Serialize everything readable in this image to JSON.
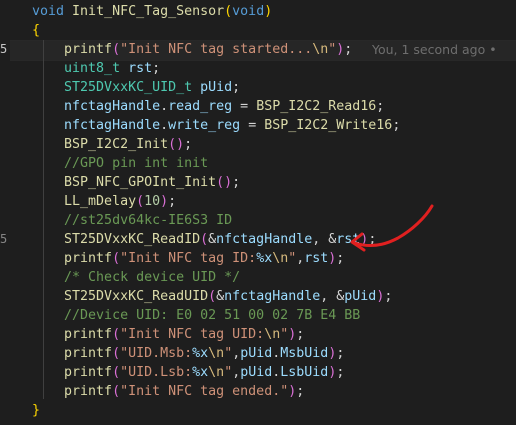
{
  "editor": {
    "line_numbers": [
      "",
      "",
      "5",
      "",
      "",
      "",
      "",
      "",
      "",
      "",
      "",
      "",
      "",
      "",
      "5",
      "",
      "",
      "",
      "",
      "",
      "",
      ""
    ],
    "blame": "You, 1 second ago •"
  },
  "code": {
    "l0": {
      "kw": "void",
      "fn": "Init_NFC_Tag_Sensor",
      "p1": "(",
      "arg": "void",
      "p2": ")"
    },
    "l1": {
      "brace": "{"
    },
    "l2": {
      "fn": "printf",
      "p1": "(",
      "str1": "\"Init NFC tag started...",
      "esc": "\\n",
      "str2": "\"",
      "p2": ")",
      "semi": ";"
    },
    "l3": {
      "ty": "uint8_t",
      "var": "rst",
      "semi": ";"
    },
    "l4": {
      "ty": "ST25DVxxKC_UID_t",
      "var": "pUid",
      "semi": ";"
    },
    "l5": {
      "var1": "nfctagHandle",
      "dot": ".",
      "var2": "read_reg",
      "eq": " = ",
      "fn": "BSP_I2C2_Read16",
      "semi": ";"
    },
    "l6": {
      "var1": "nfctagHandle",
      "dot": ".",
      "var2": "write_reg",
      "eq": " = ",
      "fn": "BSP_I2C2_Write16",
      "semi": ";"
    },
    "l7": {
      "fn": "BSP_I2C2_Init",
      "p": "()",
      "semi": ";"
    },
    "l8": {
      "cmt": "//GPO pin int init"
    },
    "l9": {
      "fn": "BSP_NFC_GPOInt_Init",
      "p": "()",
      "semi": ";"
    },
    "l10": {
      "fn": "LL_mDelay",
      "p1": "(",
      "num": "10",
      "p2": ")",
      "semi": ";"
    },
    "l11": {
      "cmt": "//st25dv64kc-IE6S3 ID"
    },
    "l12": {
      "fn": "ST25DVxxKC_ReadID",
      "p1": "(",
      "amp1": "&",
      "var1": "nfctagHandle",
      "comma": ", ",
      "amp2": "&",
      "var2": "rst",
      "p2": ")",
      "semi": ";"
    },
    "l13": {
      "fn": "printf",
      "p1": "(",
      "str1": "\"Init NFC tag ID:",
      "esc1": "%x",
      "esc2": "\\n",
      "str2": "\"",
      "comma": ",",
      "var": "rst",
      "p2": ")",
      "semi": ";"
    },
    "l14": {
      "cmt": "/* Check device UID */"
    },
    "l15": {
      "fn": "ST25DVxxKC_ReadUID",
      "p1": "(",
      "amp1": "&",
      "var1": "nfctagHandle",
      "comma": ", ",
      "amp2": "&",
      "var2": "pUid",
      "p2": ")",
      "semi": ";"
    },
    "l16": {
      "cmt": "//Device UID: E0 02 51 00 02 7B E4 BB"
    },
    "l17": {
      "fn": "printf",
      "p1": "(",
      "str1": "\"Init NFC tag UID:",
      "esc": "\\n",
      "str2": "\"",
      "p2": ")",
      "semi": ";"
    },
    "l18": {
      "fn": "printf",
      "p1": "(",
      "str1": "\"UID.Msb:",
      "esc1": "%x",
      "esc2": "\\n",
      "str2": "\"",
      "comma": ",",
      "var1": "pUid",
      "dot": ".",
      "var2": "MsbUid",
      "p2": ")",
      "semi": ";"
    },
    "l19": {
      "fn": "printf",
      "p1": "(",
      "str1": "\"UID.Lsb:",
      "esc1": "%x",
      "esc2": "\\n",
      "str2": "\"",
      "comma": ",",
      "var1": "pUid",
      "dot": ".",
      "var2": "LsbUid",
      "p2": ")",
      "semi": ";"
    },
    "l20": {
      "fn": "printf",
      "p1": "(",
      "str1": "\"Init NFC tag ended.\"",
      "p2": ")",
      "semi": ";"
    },
    "l21": {
      "brace": "}"
    }
  },
  "colors": {
    "background": "#1e1e1e",
    "annotation": "#e02020"
  }
}
